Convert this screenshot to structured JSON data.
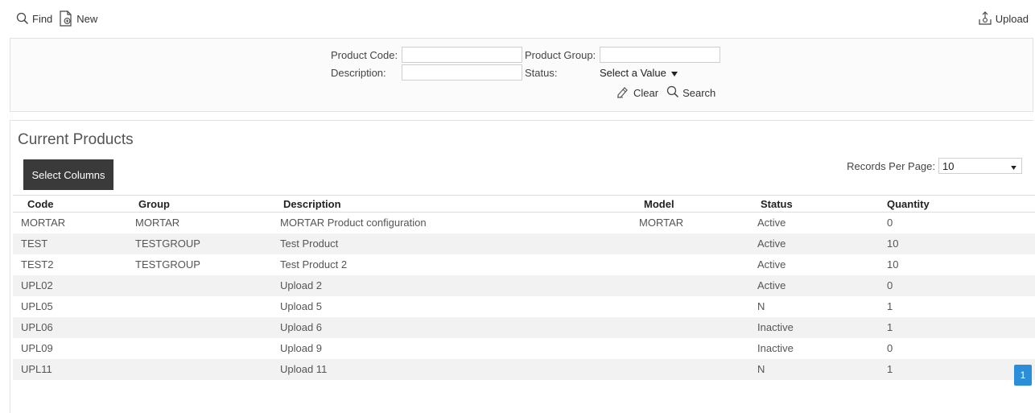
{
  "toolbar": {
    "find_label": "Find",
    "new_label": "New",
    "upload_label": "Upload"
  },
  "filter": {
    "product_code_label": "Product Code:",
    "product_group_label": "Product Group:",
    "description_label": "Description:",
    "status_label": "Status:",
    "product_code_value": "",
    "product_group_value": "",
    "description_value": "",
    "status_value": "Select a Value",
    "clear_label": "Clear",
    "search_label": "Search"
  },
  "products": {
    "title": "Current Products",
    "select_columns_label": "Select Columns",
    "records_per_page_label": "Records Per Page:",
    "records_per_page_value": "10",
    "columns": [
      "Code",
      "Group",
      "Description",
      "Model",
      "Status",
      "Quantity"
    ],
    "rows": [
      {
        "code": "MORTAR",
        "group": "MORTAR",
        "description": "MORTAR Product configuration",
        "model": "MORTAR",
        "status": "Active",
        "quantity": "0"
      },
      {
        "code": "TEST",
        "group": "TESTGROUP",
        "description": "Test Product",
        "model": "",
        "status": "Active",
        "quantity": "10"
      },
      {
        "code": "TEST2",
        "group": "TESTGROUP",
        "description": "Test Product 2",
        "model": "",
        "status": "Active",
        "quantity": "10"
      },
      {
        "code": "UPL02",
        "group": "",
        "description": "Upload 2",
        "model": "",
        "status": "Active",
        "quantity": "0"
      },
      {
        "code": "UPL05",
        "group": "",
        "description": "Upload 5",
        "model": "",
        "status": "N",
        "quantity": "1"
      },
      {
        "code": "UPL06",
        "group": "",
        "description": "Upload 6",
        "model": "",
        "status": "Inactive",
        "quantity": "1"
      },
      {
        "code": "UPL09",
        "group": "",
        "description": "Upload 9",
        "model": "",
        "status": "Inactive",
        "quantity": "0"
      },
      {
        "code": "UPL11",
        "group": "",
        "description": "Upload 11",
        "model": "",
        "status": "N",
        "quantity": "1"
      }
    ],
    "current_page": "1"
  },
  "colors": {
    "accent": "#2a8fd8",
    "dark_button": "#3a3a3a",
    "row_stripe": "#f2f2f2"
  }
}
